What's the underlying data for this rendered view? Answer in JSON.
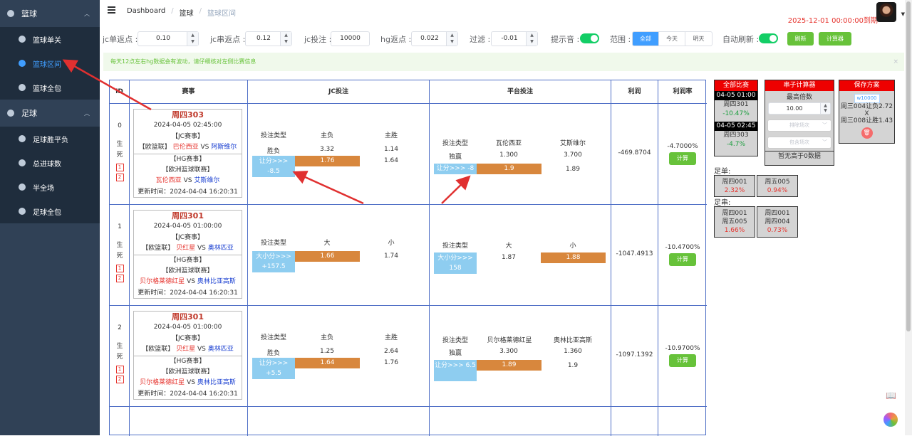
{
  "sidebar": {
    "groups": [
      {
        "label": "篮球",
        "items": [
          "篮球单关",
          "篮球区间",
          "篮球全包"
        ]
      },
      {
        "label": "足球",
        "items": [
          "足球胜平负",
          "总进球数",
          "半全场",
          "足球全包"
        ]
      }
    ]
  },
  "header": {
    "breadcrumbs": [
      "Dashboard",
      "篮球",
      "篮球区间"
    ],
    "expiry": "2025-12-01 00:00:00到期"
  },
  "filters": {
    "jc_single_label": "jc单返点 :",
    "jc_single_value": "0.10",
    "jc_parlay_label": "jc串返点 :",
    "jc_parlay_value": "0.12",
    "jc_bet_label": "jc投注 :",
    "jc_bet_value": "10000",
    "hg_label": "hg返点 :",
    "hg_value": "0.022",
    "filter_label": "过滤 :",
    "filter_value": "-0.01",
    "sound_label": "提示音 :",
    "range_label": "范围 :",
    "range_options": [
      "全部",
      "今天",
      "明天"
    ],
    "auto_label": "自动刷新 :",
    "refresh_btn": "刷新",
    "calc_btn": "计算器"
  },
  "notice": "每天12点左右hg数据会有波动，请仔细核对左侧比赛信息",
  "table": {
    "headers": [
      "ID",
      "赛事",
      "JC投注",
      "平台投注",
      "利润",
      "利润率"
    ],
    "rows": [
      {
        "id": "0",
        "status1": "生",
        "status2": "死",
        "code": "周四303",
        "time": "2024-04-05 02:45:00",
        "jc_tag": "【JC赛事】",
        "jc_league": "【欧篮联】",
        "jc_home": "巴伦西亚",
        "vs": "VS",
        "jc_away": "阿斯维尔",
        "hg_tag": "【HG赛事】",
        "hg_league": "【欧洲篮球联赛】",
        "hg_home": "瓦伦西亚",
        "hg_away": "艾斯维尔",
        "update": "更新时间：2024-04-04 16:20:31",
        "jc_type_h": "投注类型",
        "jc_c1_h": "主负",
        "jc_c2_h": "主胜",
        "jc_type": "胜负",
        "jc_c1": "3.32",
        "jc_c2": "1.14",
        "jc_hl": "让分>>> -8.5",
        "jc_hl_c1": "1.76",
        "jc_hl_c2": "1.64",
        "pf_type_h": "投注类型",
        "pf_c1_h": "瓦伦西亚",
        "pf_c2_h": "艾斯维尔",
        "pf_type": "独赢",
        "pf_c1": "1.300",
        "pf_c2": "3.700",
        "pf_hl": "让分>>> -8",
        "pf_hl_c1": "1.9",
        "pf_hl_c2": "1.89",
        "profit": "-469.8704",
        "rate": "-4.7000%",
        "calc": "计算"
      },
      {
        "id": "1",
        "status1": "生",
        "status2": "死",
        "code": "周四301",
        "time": "2024-04-05 01:00:00",
        "jc_tag": "【JC赛事】",
        "jc_league": "【欧篮联】",
        "jc_home": "贝红星",
        "vs": "VS",
        "jc_away": "奥林匹亚",
        "hg_tag": "【HG赛事】",
        "hg_league": "【欧洲篮球联赛】",
        "hg_home": "贝尔格莱德红星",
        "hg_away": "奥林比亚高斯",
        "update": "更新时间：2024-04-04 16:20:31",
        "jc_type_h": "投注类型",
        "jc_c1_h": "大",
        "jc_c2_h": "小",
        "jc_hl": "大小分>>> +157.5",
        "jc_hl_c1": "1.66",
        "jc_hl_c2": "1.74",
        "pf_type_h": "投注类型",
        "pf_c1_h": "大",
        "pf_c2_h": "小",
        "pf_hl": "大小分>>> 158",
        "pf_hl_c1": "1.87",
        "pf_hl_c2": "1.88",
        "profit": "-1047.4913",
        "rate": "-10.4700%",
        "calc": "计算"
      },
      {
        "id": "2",
        "status1": "生",
        "status2": "死",
        "code": "周四301",
        "time": "2024-04-05 01:00:00",
        "jc_tag": "【JC赛事】",
        "jc_league": "【欧篮联】",
        "jc_home": "贝红星",
        "vs": "VS",
        "jc_away": "奥林匹亚",
        "hg_tag": "【HG赛事】",
        "hg_league": "【欧洲篮球联赛】",
        "hg_home": "贝尔格莱德红星",
        "hg_away": "奥林比亚高斯",
        "update": "更新时间：2024-04-04 16:20:31",
        "jc_type_h": "投注类型",
        "jc_c1_h": "主负",
        "jc_c2_h": "主胜",
        "jc_type": "胜负",
        "jc_c1": "1.25",
        "jc_c2": "2.64",
        "jc_hl": "让分>>> +5.5",
        "jc_hl_c1": "1.64",
        "jc_hl_c2": "1.76",
        "pf_type_h": "投注类型",
        "pf_c1_h": "贝尔格莱德红星",
        "pf_c2_h": "奥林比亚高斯",
        "pf_type": "独赢",
        "pf_c1": "3.300",
        "pf_c2": "1.360",
        "pf_hl": "让分>>> 6.5",
        "pf_hl_c1": "1.89",
        "pf_hl_c2": "1.9",
        "profit": "-1097.1392",
        "rate": "-10.9700%",
        "calc": "计算"
      }
    ]
  },
  "all_matches": {
    "title": "全部比赛",
    "entries": [
      {
        "time": "04-05 01:00",
        "code": "周四301",
        "pct": "-10.47%"
      },
      {
        "time": "04-05 02:45",
        "code": "周四303",
        "pct": "-4.7%"
      }
    ]
  },
  "parlay_calc": {
    "title": "串子计算器",
    "max_label": "最高倍数",
    "max_value": "10.00",
    "exclude_placeholder": "排除场次",
    "include_placeholder": "包含场次",
    "empty_text": "暂无高于0数据"
  },
  "saved": {
    "title": "保存方案",
    "tag": "w10000",
    "line1": "周三004让负2.72",
    "x": "X",
    "line2": "周三008让胜1.43"
  },
  "football_single": {
    "label": "足单:",
    "cells": [
      {
        "code": "周四001",
        "pct": "2.32%"
      },
      {
        "code": "周五005",
        "pct": "0.94%"
      }
    ]
  },
  "football_parlay": {
    "label": "足串:",
    "cells": [
      {
        "code1": "周四001",
        "code2": "周五005",
        "pct": "1.66%"
      },
      {
        "code1": "周四001",
        "code2": "周四004",
        "pct": "0.73%"
      }
    ]
  }
}
